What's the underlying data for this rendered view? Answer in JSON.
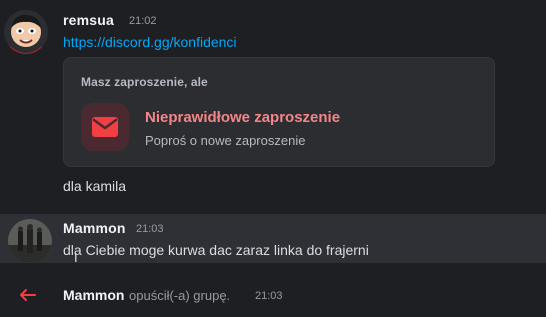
{
  "messages": [
    {
      "author": "remsua",
      "timestamp": "21:02",
      "avatar_icon": "cartoon-face-avatar",
      "link": "https://discord.gg/konfidenci",
      "invite": {
        "header": "Masz zaproszenie, ale",
        "title": "Nieprawidłowe zaproszenie",
        "subtitle": "Poproś o nowe zaproszenie",
        "icon": "envelope-icon",
        "accent_color": "#f23f43"
      },
      "text": "dla kamila"
    },
    {
      "author": "Mammon",
      "timestamp": "21:03",
      "avatar_icon": "photo-avatar",
      "text": "dla Ciebie moge kurwa dac zaraz linka do frajerni"
    }
  ],
  "system": {
    "icon": "leave-arrow-icon",
    "user": "Mammon",
    "text": "opuścił(-a) grupę.",
    "timestamp": "21:03"
  }
}
